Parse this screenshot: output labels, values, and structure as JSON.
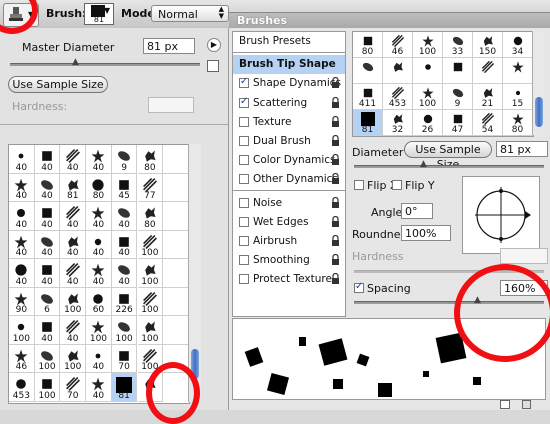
{
  "toolbar": {
    "brush_label": "Brush:",
    "brush_size": "81",
    "mode_label": "Mode:",
    "mode_value": "Normal",
    "panel_tab": "Brushes"
  },
  "left": {
    "master_diameter_label": "Master Diameter",
    "master_diameter_value": "81 px",
    "use_sample_size": "Use Sample Size",
    "hardness_label": "Hardness:",
    "grid_numbers": [
      [
        "40",
        "40",
        "40",
        "40",
        "9",
        "80",
        ""
      ],
      [
        "40",
        "40",
        "81",
        "80",
        "45",
        "77",
        ""
      ],
      [
        "40",
        "40",
        "40",
        "40",
        "40",
        "80",
        ""
      ],
      [
        "40",
        "40",
        "40",
        "40",
        "40",
        "100",
        ""
      ],
      [
        "40",
        "40",
        "40",
        "40",
        "40",
        "100",
        ""
      ],
      [
        "90",
        "6",
        "100",
        "60",
        "226",
        "100",
        ""
      ],
      [
        "100",
        "40",
        "40",
        "100",
        "100",
        "100",
        ""
      ],
      [
        "46",
        "100",
        "100",
        "40",
        "70",
        "100",
        ""
      ],
      [
        "453",
        "100",
        "70",
        "40",
        "81",
        ""
      ]
    ]
  },
  "right": {
    "menu": [
      {
        "label": "Brush Presets",
        "checkbox": false,
        "checked": false,
        "lock": false,
        "selected": false
      },
      {
        "label": "Brush Tip Shape",
        "checkbox": false,
        "checked": false,
        "lock": false,
        "selected": true
      },
      {
        "label": "Shape Dynamics",
        "checkbox": true,
        "checked": true,
        "lock": true,
        "selected": false
      },
      {
        "label": "Scattering",
        "checkbox": true,
        "checked": true,
        "lock": true,
        "selected": false
      },
      {
        "label": "Texture",
        "checkbox": true,
        "checked": false,
        "lock": true,
        "selected": false
      },
      {
        "label": "Dual Brush",
        "checkbox": true,
        "checked": false,
        "lock": true,
        "selected": false
      },
      {
        "label": "Color Dynamics",
        "checkbox": true,
        "checked": false,
        "lock": true,
        "selected": false
      },
      {
        "label": "Other Dynamics",
        "checkbox": true,
        "checked": false,
        "lock": true,
        "selected": false
      },
      {
        "label": "Noise",
        "checkbox": true,
        "checked": false,
        "lock": true,
        "selected": false
      },
      {
        "label": "Wet Edges",
        "checkbox": true,
        "checked": false,
        "lock": true,
        "selected": false
      },
      {
        "label": "Airbrush",
        "checkbox": true,
        "checked": false,
        "lock": true,
        "selected": false
      },
      {
        "label": "Smoothing",
        "checkbox": true,
        "checked": false,
        "lock": true,
        "selected": false
      },
      {
        "label": "Protect Texture",
        "checkbox": true,
        "checked": false,
        "lock": true,
        "selected": false
      }
    ],
    "tip_numbers": [
      [
        "80",
        "46",
        "100",
        "33",
        "150",
        "34"
      ],
      [
        "",
        "",
        "",
        "",
        "",
        ""
      ],
      [
        "411",
        "453",
        "100",
        "9",
        "21",
        "15"
      ],
      [
        "81",
        "32",
        "26",
        "47",
        "54",
        "80"
      ]
    ],
    "diameter_label": "Diameter",
    "use_sample_size": "Use Sample Size",
    "diameter_value": "81 px",
    "flip_x": "Flip X",
    "flip_y": "Flip Y",
    "angle_label": "Angle:",
    "angle_value": "0°",
    "roundness_label": "Roundness:",
    "roundness_value": "100%",
    "hardness_label": "Hardness",
    "spacing_label": "Spacing",
    "spacing_value": "160%"
  },
  "colors": {
    "annotation_red": "#f20f13",
    "selection_blue": "#b5d1f3"
  }
}
